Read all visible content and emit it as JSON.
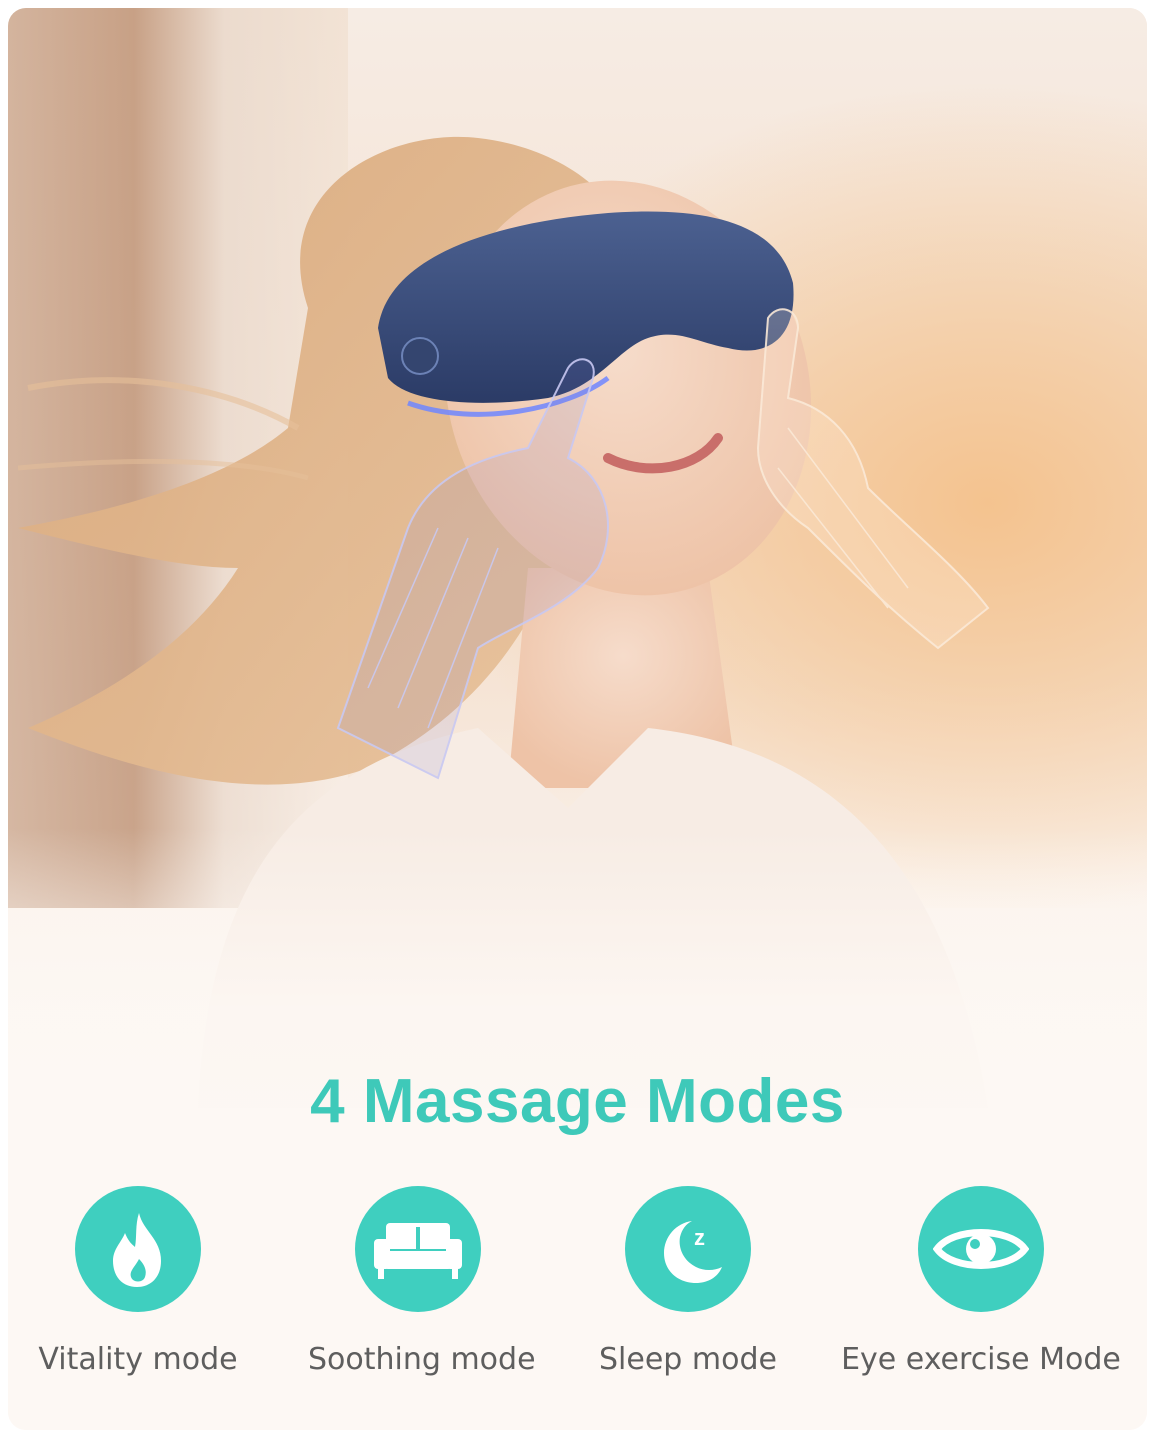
{
  "headline": "4 Massage Modes",
  "accent_color": "#3fcfbf",
  "modes": [
    {
      "label": "Vitality mode",
      "icon": "flame-icon"
    },
    {
      "label": "Soothing mode",
      "icon": "sofa-icon"
    },
    {
      "label": "Sleep mode",
      "icon": "moon-sleep-icon"
    },
    {
      "label": "Eye exercise Mode",
      "icon": "eye-icon"
    }
  ]
}
